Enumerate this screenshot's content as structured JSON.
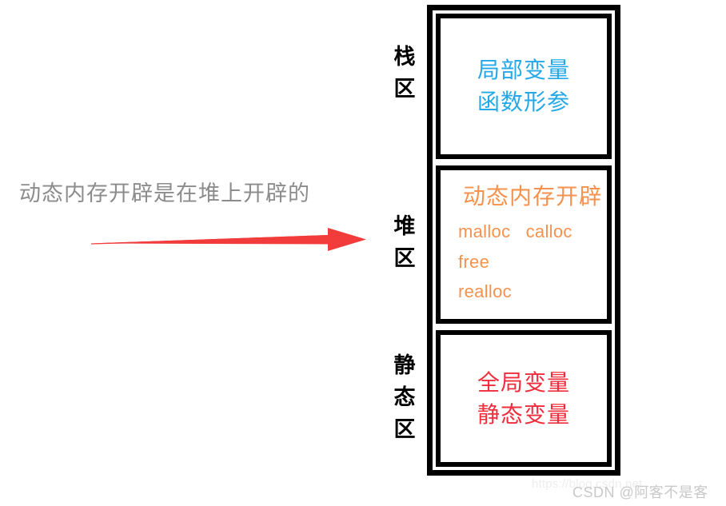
{
  "caption": {
    "text": "动态内存开辟是在堆上开辟的"
  },
  "arrow": {
    "name": "red-arrow",
    "color": "#f23b3b",
    "direction": "right"
  },
  "diagram": {
    "title": "memory-layout",
    "regions": [
      {
        "key": "stack",
        "side_label_chars": [
          "栈",
          "区"
        ],
        "text_color": "#25a8e8",
        "lines": [
          "局部变量",
          "函数形参"
        ]
      },
      {
        "key": "heap",
        "side_label_chars": [
          "堆",
          "区"
        ],
        "text_color": "#f5924e",
        "title": "动态内存开辟",
        "functions": [
          "malloc   calloc",
          "free",
          "realloc"
        ]
      },
      {
        "key": "static",
        "side_label_chars": [
          "静",
          "态",
          "区"
        ],
        "text_color": "#f02d3c",
        "lines": [
          "全局变量",
          "静态变量"
        ]
      }
    ]
  },
  "watermark": {
    "url": "https://blog.csdn.net",
    "credit": "CSDN @阿客不是客"
  },
  "colors": {
    "blue": "#25a8e8",
    "orange": "#f5924e",
    "red": "#f02d3c",
    "gray_caption": "#8c8c8c",
    "frame": "#000000",
    "background": "#ffffff"
  }
}
